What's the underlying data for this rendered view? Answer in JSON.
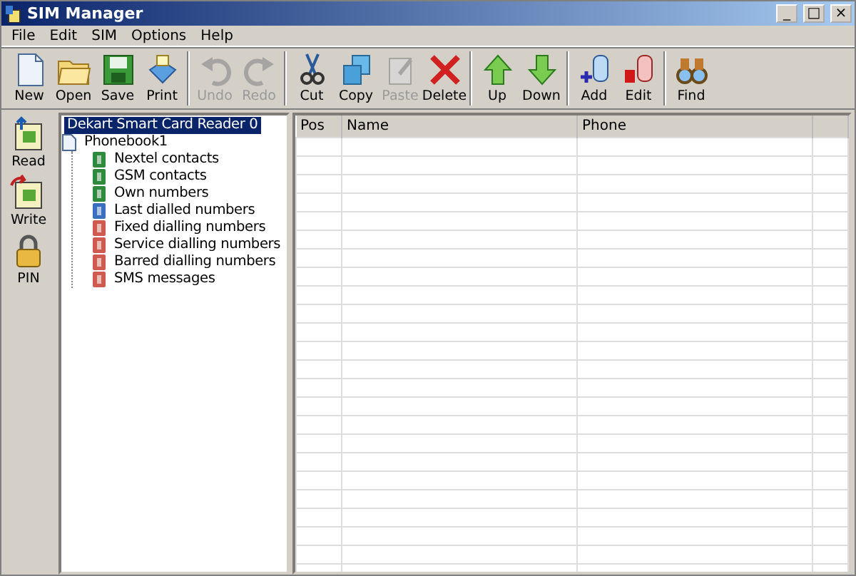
{
  "window": {
    "title": "SIM Manager",
    "controls": [
      "_",
      "□",
      "×"
    ]
  },
  "menu": [
    "File",
    "Edit",
    "SIM",
    "Options",
    "Help"
  ],
  "toolbar": [
    [
      {
        "label": "New",
        "disabled": false
      },
      {
        "label": "Open",
        "disabled": false
      },
      {
        "label": "Save",
        "disabled": false
      },
      {
        "label": "Print",
        "disabled": false
      }
    ],
    [
      {
        "label": "Undo",
        "disabled": true
      },
      {
        "label": "Redo",
        "disabled": true
      }
    ],
    [
      {
        "label": "Cut",
        "disabled": false
      },
      {
        "label": "Copy",
        "disabled": false
      },
      {
        "label": "Paste",
        "disabled": true
      },
      {
        "label": "Delete",
        "disabled": false
      }
    ],
    [
      {
        "label": "Up",
        "disabled": false
      },
      {
        "label": "Down",
        "disabled": false
      }
    ],
    [
      {
        "label": "Add",
        "disabled": false
      },
      {
        "label": "Edit",
        "disabled": false
      }
    ],
    [
      {
        "label": "Find",
        "disabled": false
      }
    ]
  ],
  "side_buttons": [
    "Read",
    "Write",
    "PIN"
  ],
  "tree": {
    "label": "Dekart Smart Card Reader 0",
    "selected": true,
    "children": [
      {
        "label": "Phonebook1",
        "selected": false,
        "children": [
          {
            "label": "Nextel contacts",
            "selected": false,
            "color": "#2e8b3e"
          },
          {
            "label": "GSM contacts",
            "selected": false,
            "color": "#2e8b3e"
          },
          {
            "label": "Own numbers",
            "selected": false,
            "color": "#2e8b3e"
          },
          {
            "label": "Last dialled numbers",
            "selected": false,
            "color": "#3a6fc0"
          },
          {
            "label": "Fixed dialling numbers",
            "selected": false,
            "color": "#d05a50"
          },
          {
            "label": "Service dialling numbers",
            "selected": false,
            "color": "#d05a50"
          },
          {
            "label": "Barred dialling numbers",
            "selected": false,
            "color": "#d05a50"
          },
          {
            "label": "SMS messages",
            "selected": false,
            "color": "#d05a50"
          }
        ]
      }
    ]
  },
  "table": {
    "columns": [
      "Pos",
      "Name",
      "Phone"
    ]
  }
}
